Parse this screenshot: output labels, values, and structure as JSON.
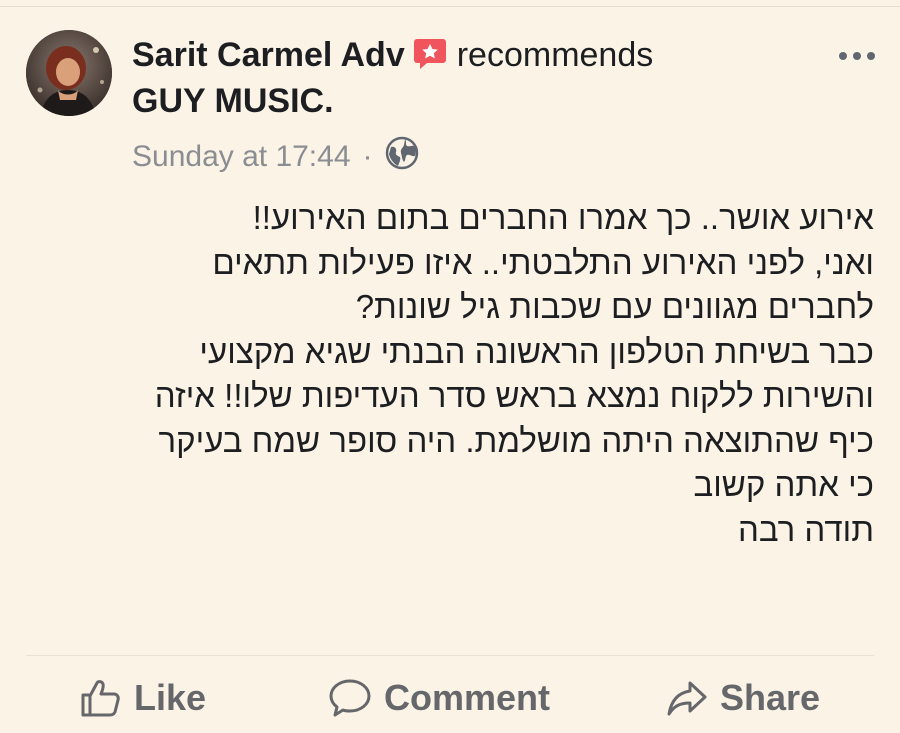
{
  "post": {
    "author": "Sarit Carmel Adv",
    "action_text": "recommends",
    "page_name": "GUY MUSIC.",
    "timestamp": "Sunday at 17:44",
    "separator": "·",
    "privacy_icon": "globe-icon",
    "recommend_icon": "recommend-badge-icon",
    "more_icon": "more-options-icon",
    "body_lines": [
      "אירוע אושר.. כך אמרו החברים בתום האירוע!!",
      "ואני, לפני האירוע התלבטתי.. איזו פעילות תתאים",
      "לחברים מגוונים  עם שכבות גיל שונות?",
      "כבר בשיחת הטלפון הראשונה הבנתי שגיא מקצועי",
      "והשירות ללקוח נמצא בראש סדר העדיפות שלו!! איזה",
      "כיף שהתוצאה היתה מושלמת. היה סופר שמח בעיקר",
      "כי אתה קשוב",
      "תודה רבה"
    ]
  },
  "actions": {
    "like": "Like",
    "comment": "Comment",
    "share": "Share"
  },
  "colors": {
    "background": "#fbf3e6",
    "badge": "#f0545c",
    "muted_text": "#65676b"
  }
}
